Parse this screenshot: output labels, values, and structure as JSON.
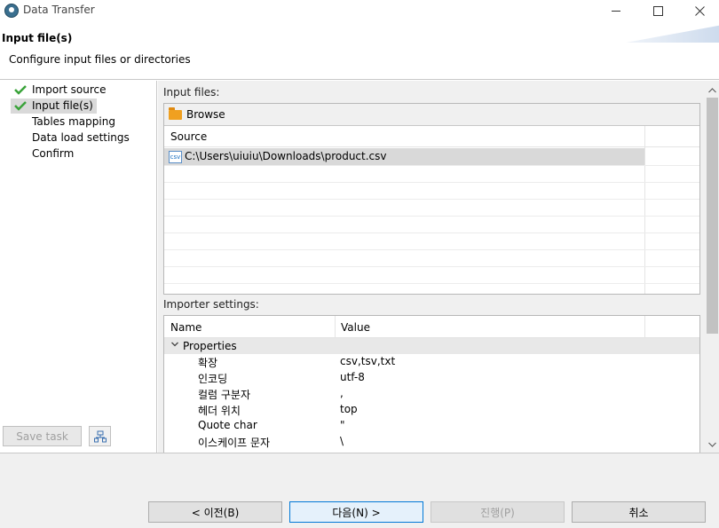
{
  "window": {
    "title": "Data Transfer",
    "minimize_icon": "minimize-icon",
    "maximize_icon": "maximize-icon",
    "close_icon": "close-icon"
  },
  "header": {
    "title": "Input file(s)",
    "subtitle": "Configure input files or directories"
  },
  "nav": {
    "items": [
      {
        "label": "Import source",
        "done": true,
        "selected": false
      },
      {
        "label": "Input file(s)",
        "done": true,
        "selected": true
      },
      {
        "label": "Tables mapping",
        "done": false,
        "selected": false
      },
      {
        "label": "Data load settings",
        "done": false,
        "selected": false
      },
      {
        "label": "Confirm",
        "done": false,
        "selected": false
      }
    ],
    "save_task_label": "Save task",
    "task_icon": "task-config-icon"
  },
  "input_files": {
    "label": "Input files:",
    "browse_label": "Browse",
    "column_header": "Source",
    "files": [
      {
        "icon": "csv",
        "path": "C:\\Users\\uiuiu\\Downloads\\product.csv"
      }
    ]
  },
  "importer_settings": {
    "label": "Importer settings:",
    "columns": [
      "Name",
      "Value"
    ],
    "group_label": "Properties",
    "properties": [
      {
        "name": "확장",
        "value": "csv,tsv,txt"
      },
      {
        "name": "인코딩",
        "value": "utf-8"
      },
      {
        "name": "컬럼 구분자",
        "value": ","
      },
      {
        "name": "헤더 위치",
        "value": "top"
      },
      {
        "name": "Quote char",
        "value": "\""
      },
      {
        "name": "이스케이프 문자",
        "value": "\\"
      }
    ]
  },
  "footer": {
    "back_label": "< 이전(B)",
    "next_label": "다음(N) >",
    "proceed_label": "진행(P)",
    "cancel_label": "취소"
  },
  "colors": {
    "check": "#3aa33a",
    "selection": "#d9d9d9",
    "folder": "#f0a020",
    "primary_border": "#0078d7"
  }
}
